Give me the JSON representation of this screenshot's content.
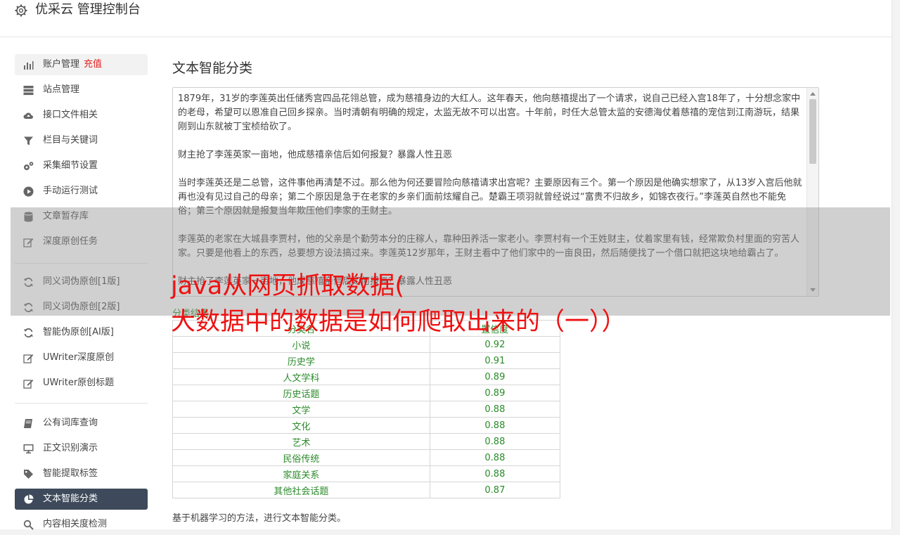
{
  "header": {
    "title": "优采云 管理控制台",
    "icon": "gear-icon"
  },
  "sidebar": {
    "items": [
      {
        "label": "账户管理",
        "badge": "充值",
        "icon": "bar-chart-icon"
      },
      {
        "label": "站点管理",
        "icon": "server-icon"
      },
      {
        "label": "接口文件相关",
        "icon": "cloud-upload-icon"
      },
      {
        "label": "栏目与关键词",
        "icon": "filter-icon"
      },
      {
        "label": "采集细节设置",
        "icon": "cogs-icon"
      },
      {
        "label": "手动运行测试",
        "icon": "play-circle-icon"
      },
      {
        "label": "文章暂存库",
        "icon": "database-icon"
      },
      {
        "label": "深度原创任务",
        "icon": "edit-icon"
      },
      {
        "label": "同义词伪原创[1版]",
        "icon": "refresh-icon"
      },
      {
        "label": "同义词伪原创[2版]",
        "icon": "refresh-icon"
      },
      {
        "label": "智能伪原创[AI版]",
        "icon": "refresh-icon"
      },
      {
        "label": "UWriter深度原创",
        "icon": "edit-icon"
      },
      {
        "label": "UWriter原创标题",
        "icon": "edit-icon"
      },
      {
        "label": "公有词库查询",
        "icon": "book-icon"
      },
      {
        "label": "正文识别演示",
        "icon": "monitor-icon"
      },
      {
        "label": "智能提取标签",
        "icon": "tag-icon"
      },
      {
        "label": "文本智能分类",
        "icon": "pie-chart-icon"
      },
      {
        "label": "内容相关度检测",
        "icon": "search-icon"
      }
    ]
  },
  "main": {
    "title": "文本智能分类",
    "text_paragraphs": [
      "1879年，31岁的李莲英出任储秀宫四品花翎总管，成为慈禧身边的大红人。这年春天，他向慈禧提出了一个请求，说自己已经入宫18年了，十分想念家中的老母，希望可以恩准自己回乡探亲。当时清朝有明确的规定，太监无故不可以出宫。十年前，时任大总管太监的安德海仗着慈禧的宠信到江南游玩，结果刚到山东就被丁宝桢给砍了。",
      "财主抢了李莲英家一亩地，他成慈禧亲信后如何报复？暴露人性丑恶",
      "当时李莲英还是二总管，这件事他再清楚不过。那么他为何还要冒险向慈禧请求出宫呢？主要原因有三个。第一个原因是他确实想家了，从13岁入宫后他就再也没有见过自己的母亲；第二个原因是急于在老家的乡亲们面前炫耀自己。楚霸王项羽就曾经说过“富贵不归故乡，如锦衣夜行。”李莲英自然也不能免俗；第三个原因就是报复当年欺压他们李家的王财主。",
      "李莲英的老家在大城县李贾村，他的父亲是个勤劳本分的庄稼人，靠种田养活一家老小。李贾村有一个王姓财主，仗着家里有钱，经常欺负村里面的穷苦人家。只要是他看上的东西，总要想方设法搞过来。李莲英12岁那年，王财主看中了他们家中的一亩良田，然后随便找了一个借口就把这块地给霸占了。",
      "财主抢了李莲英家一亩地，他成慈禧亲信后如何报复？暴露人性丑恶"
    ],
    "result_label": "分类结果",
    "table": {
      "headers": [
        "分类名",
        "置信度"
      ],
      "rows": [
        [
          "小说",
          "0.92"
        ],
        [
          "历史学",
          "0.91"
        ],
        [
          "人文学科",
          "0.89"
        ],
        [
          "历史话题",
          "0.89"
        ],
        [
          "文学",
          "0.88"
        ],
        [
          "文化",
          "0.88"
        ],
        [
          "艺术",
          "0.88"
        ],
        [
          "民俗传统",
          "0.88"
        ],
        [
          "家庭关系",
          "0.88"
        ],
        [
          "其他社会话题",
          "0.87"
        ]
      ]
    },
    "footnote": "基于机器学习的方法，进行文本智能分类。"
  },
  "overlay": {
    "line1": "java从网页抓取数据(",
    "line2": "大数据中的数据是如何爬取出来的（一））"
  },
  "colors": {
    "active_nav": "#3e4a5b",
    "recharge": "#e02020",
    "result_green": "#2a8a2a",
    "overlay_text": "#ee1111"
  }
}
